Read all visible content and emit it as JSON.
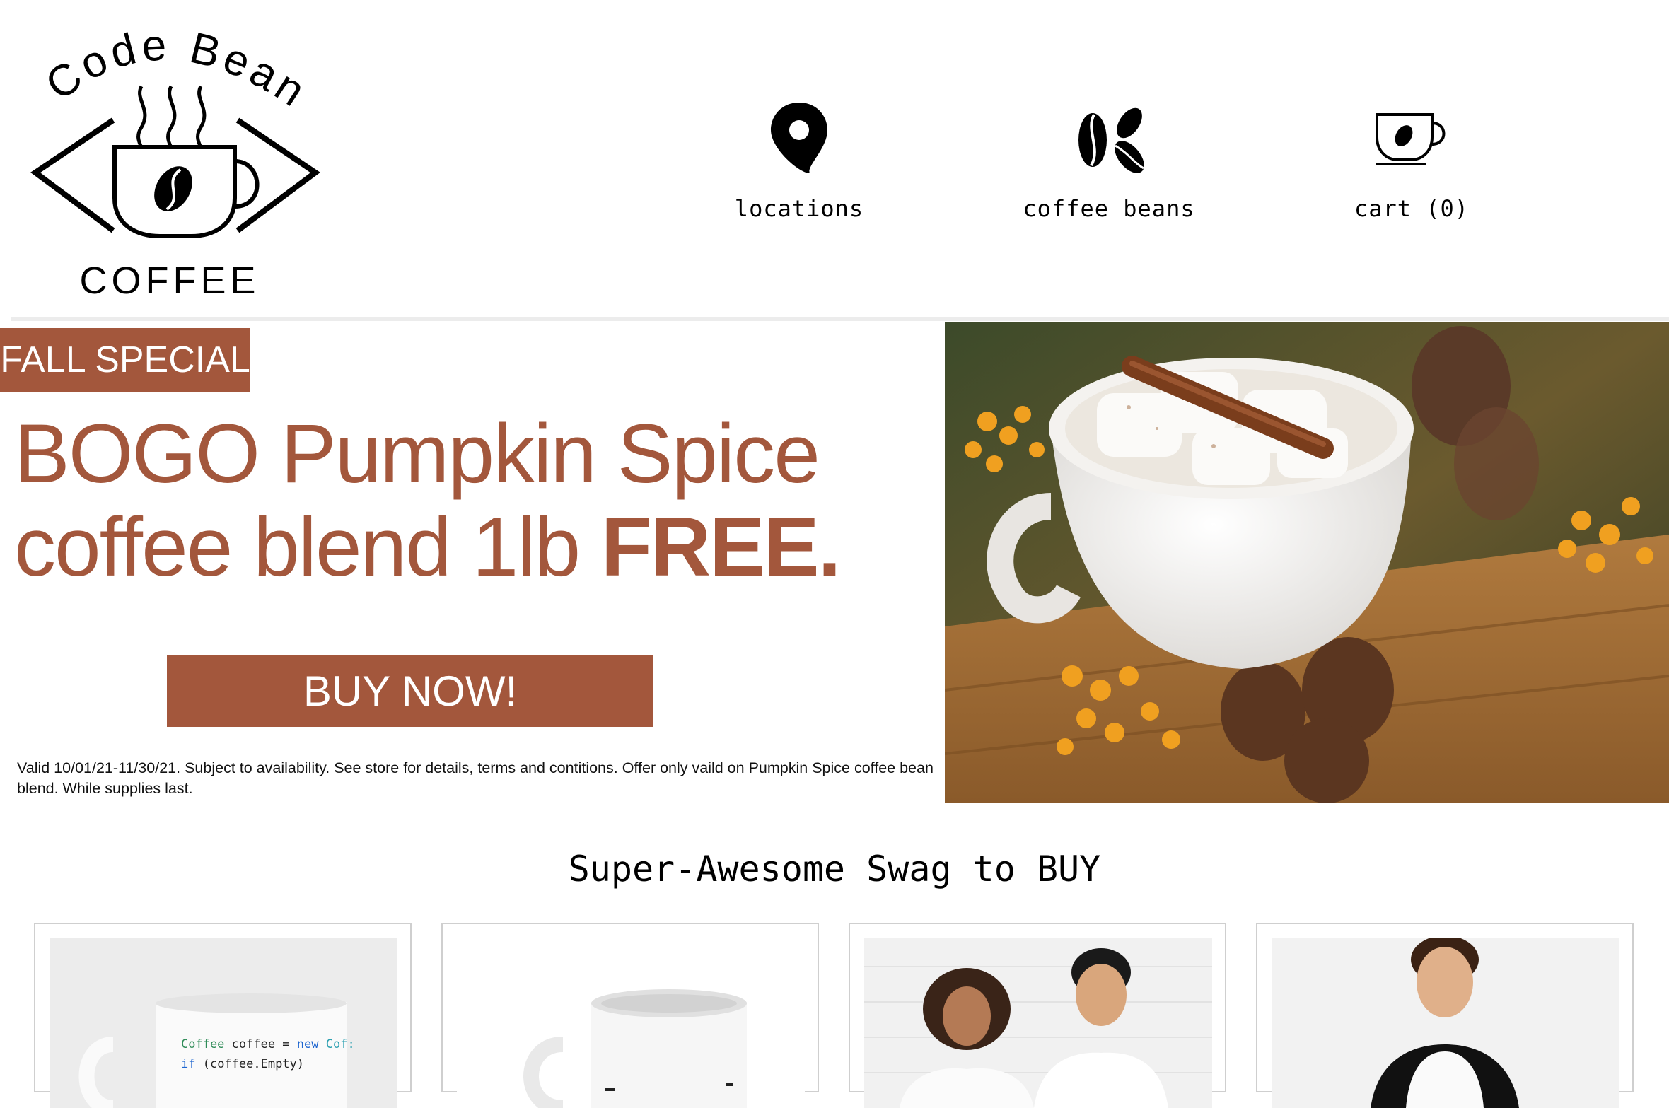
{
  "brand": {
    "logo_top_text": "Code Bean",
    "logo_bottom_text": "COFFEE"
  },
  "nav": {
    "locations": {
      "label": "locations",
      "icon": "location-pin-icon"
    },
    "beans": {
      "label": "coffee beans",
      "icon": "coffee-beans-icon"
    },
    "cart": {
      "label": "cart (0)",
      "icon": "coffee-cup-cart-icon"
    }
  },
  "hero": {
    "tag": "FALL SPECIAL",
    "headline_line1": "BOGO Pumpkin Spice",
    "headline_line2_regular": "coffee blend 1lb ",
    "headline_line2_bold": "FREE.",
    "button": "BUY NOW!",
    "fine_print": "Valid 10/01/21-11/30/21. Subject to availability. See store for details, terms and contitions. Offer only vaild on Pumpkin Spice coffee bean blend. While supplies last."
  },
  "swag": {
    "title": "Super-Awesome Swag to BUY",
    "mug_code_line1_type": "Coffee",
    "mug_code_line1_var": " coffee = ",
    "mug_code_line1_new": "new",
    "mug_code_line1_cls": " Cof:",
    "mug_code_line2_kw": "if",
    "mug_code_line2_rest": " (coffee.Empty)"
  },
  "colors": {
    "accent": "#a3573c",
    "divider": "#ececec",
    "card_border": "#cfcfcf"
  }
}
